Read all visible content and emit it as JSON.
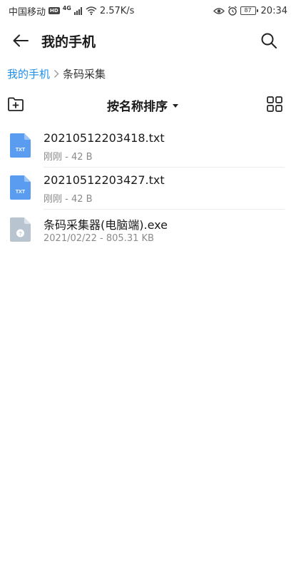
{
  "status_bar": {
    "carrier": "中国移动",
    "hd": "HD",
    "network": "4G",
    "speed": "2.57K/s",
    "battery": "87",
    "time": "20:34"
  },
  "header": {
    "title": "我的手机"
  },
  "breadcrumb": {
    "root": "我的手机",
    "current": "条码采集"
  },
  "toolbar": {
    "sort_label": "按名称排序"
  },
  "files": [
    {
      "name": "20210512203418.txt",
      "meta": "刚刚 - 42 B",
      "icon": "txt-file-icon",
      "icon_label": "TXT",
      "icon_color": "#5a9df0"
    },
    {
      "name": "20210512203427.txt",
      "meta": "刚刚 - 42 B",
      "icon": "txt-file-icon",
      "icon_label": "TXT",
      "icon_color": "#5a9df0"
    },
    {
      "name": "条码采集器(电脑端).exe",
      "meta": "2021/02/22 - 805.31 KB",
      "icon": "unknown-file-icon",
      "icon_label": "?",
      "icon_color": "#b8c4cf"
    }
  ],
  "colors": {
    "accent": "#1e8ee8",
    "txt_icon": "#5a9df0",
    "unknown_icon": "#b8c4cf"
  }
}
